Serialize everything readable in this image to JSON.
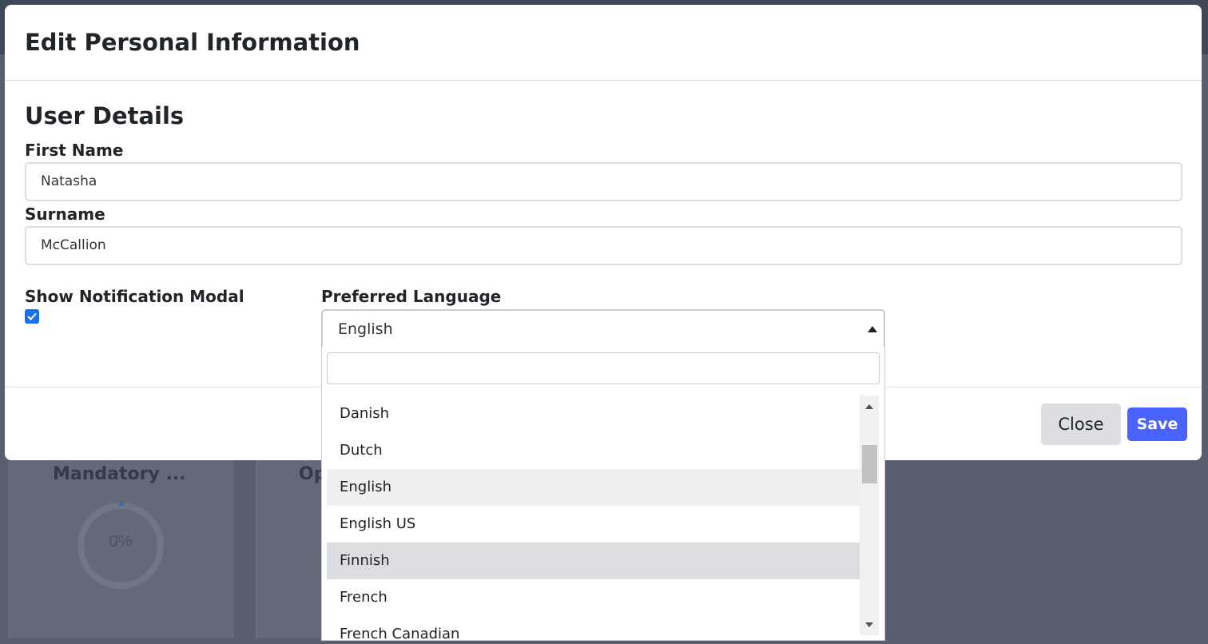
{
  "background": {
    "card1_title": "Mandatory ...",
    "card1_gauge_value": "0%",
    "card2_title": "Op"
  },
  "modal": {
    "title": "Edit Personal Information",
    "section_title": "User Details",
    "first_name": {
      "label": "First Name",
      "value": "Natasha"
    },
    "surname": {
      "label": "Surname",
      "value": "McCallion"
    },
    "notification": {
      "label": "Show Notification Modal",
      "checked": true
    },
    "language": {
      "label": "Preferred Language",
      "selected": "English",
      "search_value": "",
      "options": [
        "Danish",
        "Dutch",
        "English",
        "English US",
        "Finnish",
        "French",
        "French Canadian"
      ],
      "selected_index": 2,
      "highlighted_index": 4
    },
    "buttons": {
      "close": "Close",
      "save": "Save"
    }
  },
  "colors": {
    "primary": "#4a62ff",
    "checkbox": "#1a6ef0",
    "backdrop": "#5d6272"
  }
}
